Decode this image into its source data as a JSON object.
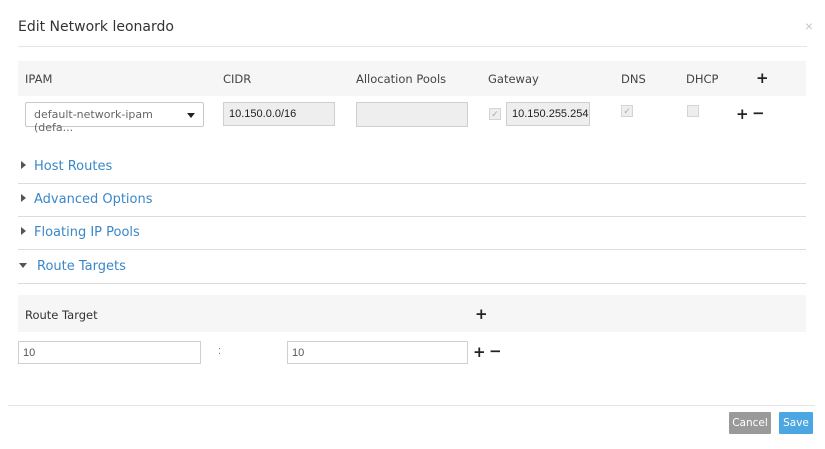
{
  "modal": {
    "title": "Edit Network leonardo",
    "close": "×"
  },
  "subnet_table": {
    "headers": {
      "ipam": "IPAM",
      "cidr": "CIDR",
      "allocation_pools": "Allocation Pools",
      "gateway": "Gateway",
      "dns": "DNS",
      "dhcp": "DHCP"
    },
    "add": "+",
    "row": {
      "ipam": "default-network-ipam (defa...",
      "cidr": "10.150.0.0/16",
      "allocation_pools": "",
      "gateway_checked": true,
      "gateway": "10.150.255.254",
      "dns_checked": true,
      "dhcp_checked": false,
      "add": "+",
      "remove": "−"
    }
  },
  "sections": {
    "host_routes": "Host Routes",
    "advanced_options": "Advanced Options",
    "floating_ip_pools": "Floating IP Pools",
    "route_targets": "Route Targets"
  },
  "route_targets": {
    "header": "Route Target",
    "add": "+",
    "row": {
      "asn": "10",
      "separator": ":",
      "target": "10",
      "add": "+",
      "remove": "−"
    }
  },
  "footer": {
    "cancel": "Cancel",
    "save": "Save"
  },
  "colors": {
    "link": "#3a87c8",
    "save": "#4ca6e1",
    "cancel": "#9a9a9a"
  }
}
